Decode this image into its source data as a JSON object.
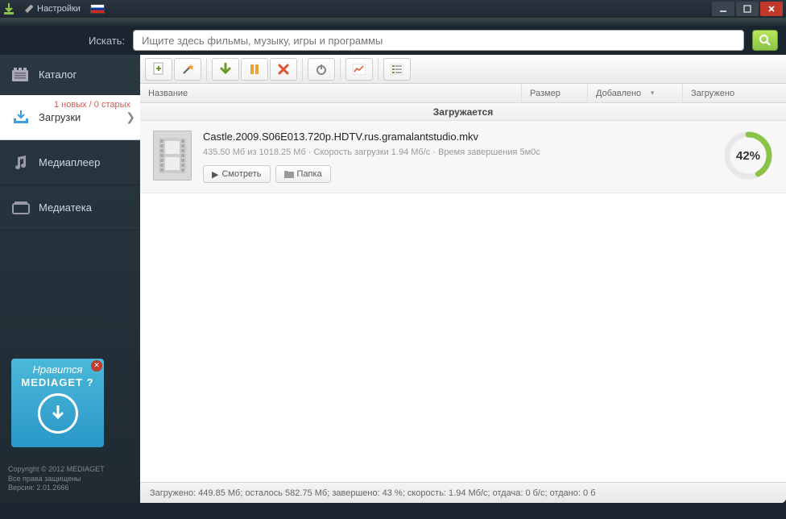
{
  "titlebar": {
    "settings_label": "Настройки"
  },
  "search": {
    "label": "Искать:",
    "placeholder": "Ищите здесь фильмы, музыку, игры и программы"
  },
  "sidebar": {
    "items": [
      {
        "label": "Каталог"
      },
      {
        "label": "Загрузки",
        "badge": "1 новых / 0 старых"
      },
      {
        "label": "Медиаплеер"
      },
      {
        "label": "Медиатека"
      }
    ]
  },
  "promo": {
    "line1": "Нравится",
    "line2": "MEDIAGET ?"
  },
  "footer": {
    "copyright": "Copyright © 2012 MEDIAGET",
    "rights": "Все права защищены",
    "version": "Версия: 2.01.2666"
  },
  "columns": {
    "name": "Название",
    "size": "Размер",
    "added": "Добавлено",
    "loaded": "Загружено"
  },
  "section": {
    "downloading": "Загружается"
  },
  "download": {
    "title": "Castle.2009.S06E013.720p.HDTV.rus.gramalantstudio.mkv",
    "stats": "435.50 Мб из 1018.25 Мб · Скорость загрузки 1.94 Мб/с · Время завершения 5м0с",
    "watch_label": "Смотреть",
    "folder_label": "Папка",
    "percent": "42%",
    "percent_value": 42
  },
  "statusbar": {
    "text": "Загружено: 449.85 Мб; осталось 582.75 Мб; завершено: 43 %; скорость: 1.94 Мб/с; отдача: 0 б/с; отдано: 0 б"
  }
}
